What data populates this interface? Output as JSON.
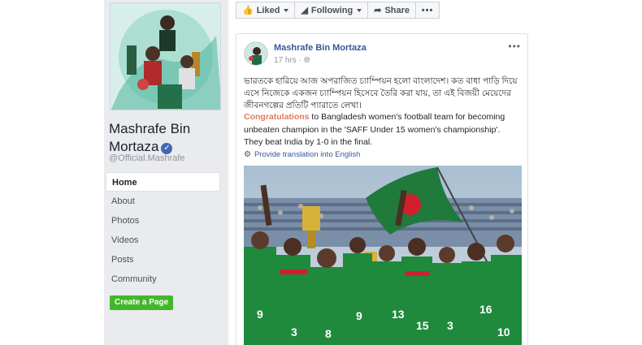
{
  "page": {
    "name": "Mashrafe Bin Mortaza",
    "handle": "@Official.Mashrafe",
    "create_page": "Create a Page"
  },
  "nav": {
    "items": [
      "Home",
      "About",
      "Photos",
      "Videos",
      "Posts",
      "Community"
    ],
    "active": "Home"
  },
  "actions": {
    "liked": "Liked",
    "following": "Following",
    "share": "Share",
    "more": "•••"
  },
  "post": {
    "author": "Mashrafe Bin Mortaza",
    "time": "17 hrs",
    "privacy_icon": "globe-icon",
    "menu": "•••",
    "bangla_text": "ভারতকে হারিয়ে আজ অপরাজিত চ্যাম্পিয়ন হলো বাংলাদেশ। কত বাধা পাড়ি দিয়ে এসে নিজেকে একজন চ্যাম্পিয়ন হিসেবে তৈরি করা যায়, তা এই বিজয়ী মেয়েদের জীবনগল্পের প্রতিটি প্যারাতে লেখা।",
    "highlight": "Congratulations",
    "english_text": " to Bangladesh women's football team for becoming unbeaten champion in the 'SAFF Under 15 women's championship'. They beat India by 1-0 in the final.",
    "translate": "Provide translation into English"
  },
  "colors": {
    "link": "#365899",
    "highlight": "#e07a5f",
    "create_button": "#42b72a",
    "jersey_green": "#1f8a3b",
    "jersey_red": "#d0202e"
  }
}
